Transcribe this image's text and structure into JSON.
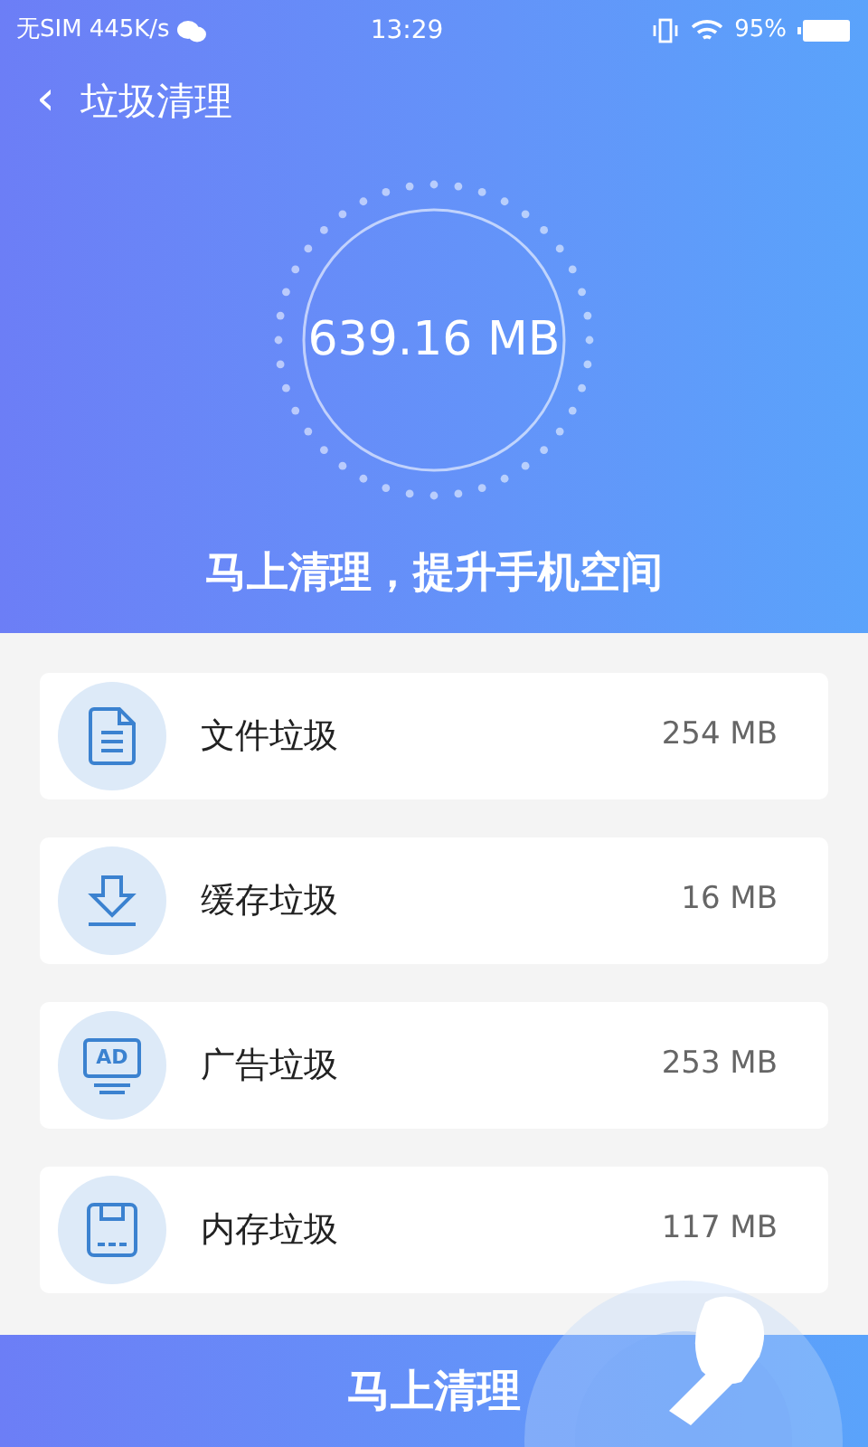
{
  "status_bar": {
    "carrier": "无SIM",
    "speed": "445K/s",
    "time": "13:29",
    "battery": "95%"
  },
  "header": {
    "back": "‹",
    "title": "垃圾清理"
  },
  "summary": {
    "size": "639.16 MB",
    "slogan": "马上清理，提升手机空间"
  },
  "items": [
    {
      "kind": "file",
      "label": "文件垃圾",
      "size": "254 MB"
    },
    {
      "kind": "download",
      "label": "缓存垃圾",
      "size": "16 MB"
    },
    {
      "kind": "ad",
      "icon_text": "AD",
      "label": "广告垃圾",
      "size": "253 MB"
    },
    {
      "kind": "memory",
      "label": "内存垃圾",
      "size": "117 MB"
    }
  ],
  "action_button": "马上清理"
}
